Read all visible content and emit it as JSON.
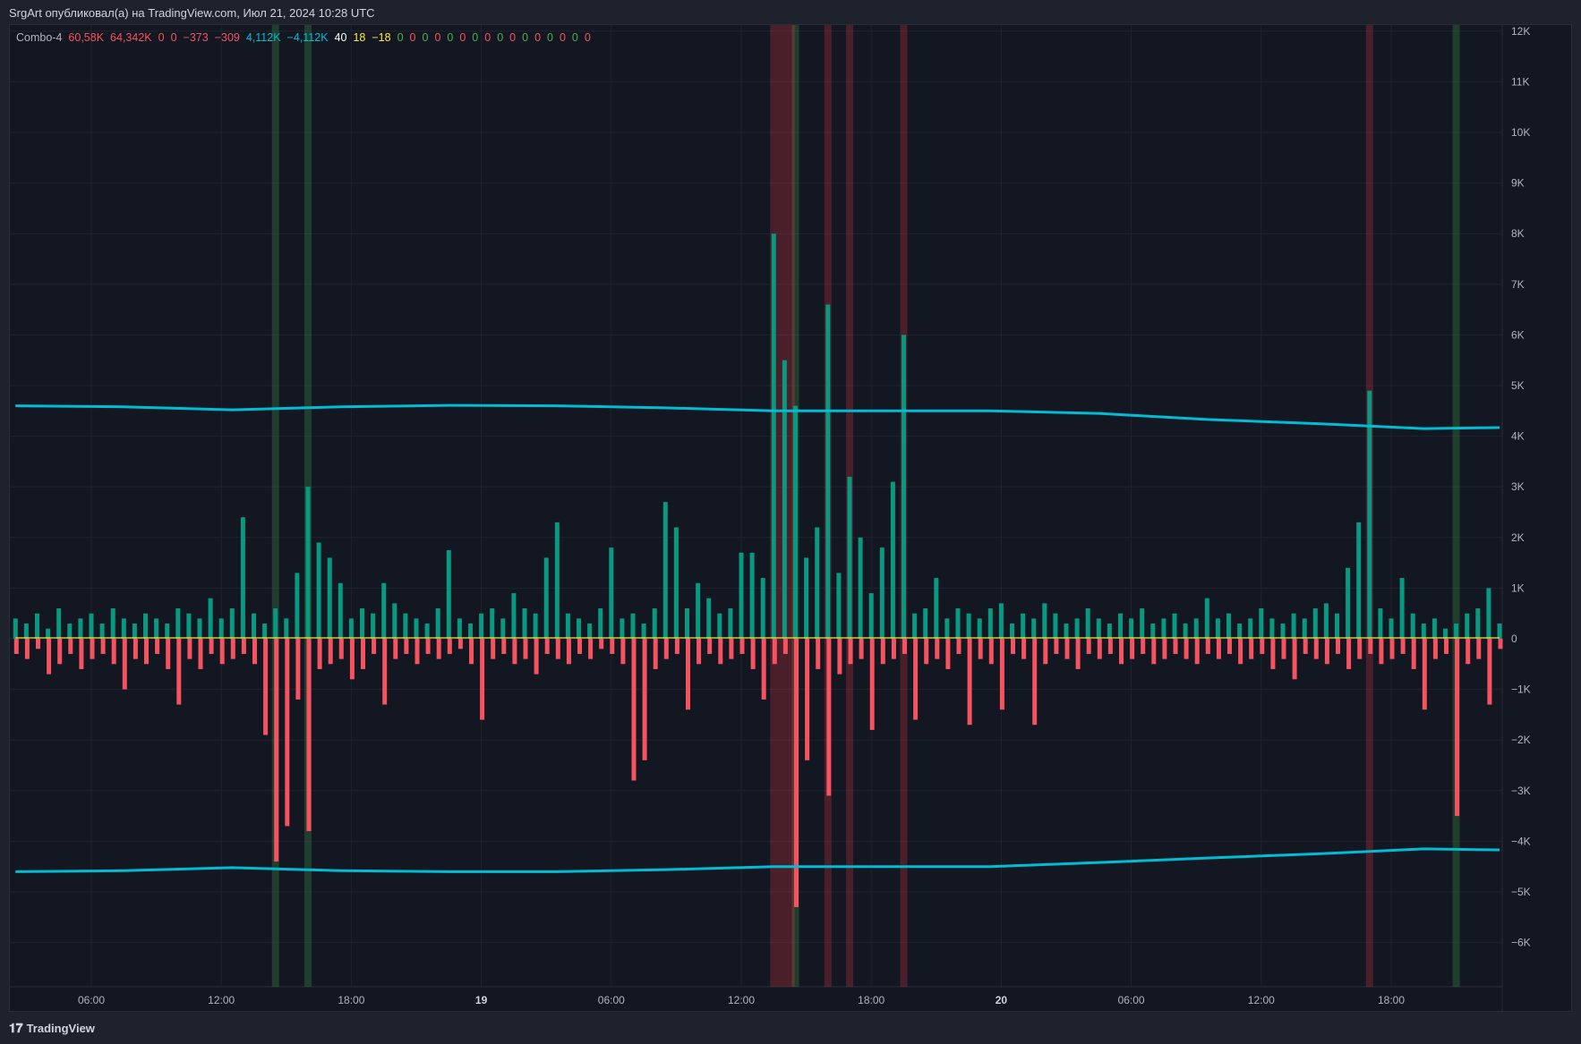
{
  "header": {
    "text": "SrgArt опубликовал(а) на TradingView.com, Июл 21, 2024 10:28 UTC"
  },
  "legend": {
    "name": "Combo-4",
    "values": [
      {
        "t": "60,58K",
        "c": "#f7525f"
      },
      {
        "t": "64,342K",
        "c": "#f7525f"
      },
      {
        "t": "0",
        "c": "#f7525f"
      },
      {
        "t": "0",
        "c": "#f7525f"
      },
      {
        "t": "−373",
        "c": "#f7525f"
      },
      {
        "t": "−309",
        "c": "#f7525f"
      },
      {
        "t": "4,112K",
        "c": "#00bcd4"
      },
      {
        "t": "−4,112K",
        "c": "#00bcd4"
      },
      {
        "t": "40",
        "c": "#ffffff"
      },
      {
        "t": "18",
        "c": "#ffeb3b"
      },
      {
        "t": "−18",
        "c": "#ffeb3b"
      },
      {
        "t": "0",
        "c": "#4caf50"
      },
      {
        "t": "0",
        "c": "#f7525f"
      },
      {
        "t": "0",
        "c": "#4caf50"
      },
      {
        "t": "0",
        "c": "#f7525f"
      },
      {
        "t": "0",
        "c": "#4caf50"
      },
      {
        "t": "0",
        "c": "#f7525f"
      },
      {
        "t": "0",
        "c": "#4caf50"
      },
      {
        "t": "0",
        "c": "#f7525f"
      },
      {
        "t": "0",
        "c": "#4caf50"
      },
      {
        "t": "0",
        "c": "#f7525f"
      },
      {
        "t": "0",
        "c": "#4caf50"
      },
      {
        "t": "0",
        "c": "#f7525f"
      },
      {
        "t": "0",
        "c": "#4caf50"
      },
      {
        "t": "0",
        "c": "#f7525f"
      },
      {
        "t": "0",
        "c": "#4caf50"
      },
      {
        "t": "0",
        "c": "#f7525f"
      }
    ]
  },
  "footer": {
    "brand": "TradingView"
  },
  "colors": {
    "up": "#089981",
    "down": "#f7525f",
    "band_line": "#00bcd4",
    "zero_line": "#ffeb3b",
    "green_band": "#4caf50",
    "red_band": "#f23645"
  },
  "chart_data": {
    "type": "bar",
    "title": "Combo-4",
    "units": "K",
    "x_start_hour": 2.5,
    "interval_hours": 0.5,
    "buy": [
      0.4,
      0.3,
      0.5,
      0.2,
      0.6,
      0.3,
      0.4,
      0.5,
      0.3,
      0.6,
      0.4,
      0.3,
      0.5,
      0.4,
      0.3,
      0.6,
      0.5,
      0.4,
      0.8,
      0.4,
      0.6,
      2.4,
      0.5,
      0.3,
      0.6,
      0.4,
      1.3,
      3.0,
      1.9,
      1.6,
      1.1,
      0.4,
      0.6,
      0.5,
      1.1,
      0.7,
      0.5,
      0.4,
      0.3,
      0.6,
      1.75,
      0.4,
      0.3,
      0.5,
      0.6,
      0.4,
      0.9,
      0.6,
      0.5,
      1.6,
      2.3,
      0.5,
      0.4,
      0.3,
      0.6,
      1.8,
      0.4,
      0.5,
      0.3,
      0.6,
      2.7,
      2.2,
      0.6,
      1.1,
      0.8,
      0.5,
      0.6,
      1.7,
      1.7,
      1.2,
      8.0,
      5.5,
      4.6,
      1.6,
      2.2,
      6.6,
      1.3,
      3.2,
      2.0,
      0.9,
      1.8,
      3.1,
      6.0,
      0.5,
      0.6,
      1.2,
      0.4,
      0.6,
      0.5,
      0.4,
      0.6,
      0.7,
      0.3,
      0.5,
      0.4,
      0.7,
      0.5,
      0.3,
      0.4,
      0.6,
      0.4,
      0.3,
      0.5,
      0.4,
      0.6,
      0.3,
      0.4,
      0.5,
      0.3,
      0.4,
      0.8,
      0.4,
      0.5,
      0.3,
      0.4,
      0.6,
      0.4,
      0.3,
      0.5,
      0.4,
      0.6,
      0.7,
      0.5,
      1.4,
      2.3,
      4.9,
      0.6,
      0.4,
      1.2,
      0.5,
      0.3,
      0.4,
      0.2,
      0.3,
      0.5,
      0.6,
      1.0,
      0.3
    ],
    "sell": [
      -0.3,
      -0.4,
      -0.2,
      -0.7,
      -0.5,
      -0.3,
      -0.6,
      -0.4,
      -0.3,
      -0.5,
      -1.0,
      -0.4,
      -0.5,
      -0.3,
      -0.6,
      -1.3,
      -0.4,
      -0.6,
      -0.3,
      -0.5,
      -0.4,
      -0.3,
      -0.5,
      -1.9,
      -4.4,
      -3.7,
      -1.2,
      -3.8,
      -0.6,
      -0.5,
      -0.4,
      -0.8,
      -0.6,
      -0.3,
      -1.3,
      -0.4,
      -0.3,
      -0.5,
      -0.3,
      -0.4,
      -0.3,
      -0.2,
      -0.5,
      -1.6,
      -0.4,
      -0.3,
      -0.5,
      -0.4,
      -0.7,
      -0.3,
      -0.4,
      -0.5,
      -0.3,
      -0.4,
      -0.2,
      -0.3,
      -0.5,
      -2.8,
      -2.4,
      -0.6,
      -0.4,
      -0.3,
      -1.4,
      -0.5,
      -0.3,
      -0.5,
      -0.4,
      -0.3,
      -0.6,
      -1.2,
      -0.5,
      -0.3,
      -5.3,
      -2.4,
      -0.6,
      -3.1,
      -0.7,
      -0.5,
      -0.4,
      -1.8,
      -0.5,
      -0.4,
      -0.3,
      -1.6,
      -0.5,
      -0.4,
      -0.6,
      -0.3,
      -1.7,
      -0.4,
      -0.5,
      -1.4,
      -0.3,
      -0.4,
      -1.7,
      -0.5,
      -0.3,
      -0.4,
      -0.6,
      -0.3,
      -0.4,
      -0.3,
      -0.5,
      -0.4,
      -0.3,
      -0.5,
      -0.4,
      -0.3,
      -0.4,
      -0.5,
      -0.3,
      -0.4,
      -0.3,
      -0.5,
      -0.4,
      -0.3,
      -0.6,
      -0.4,
      -0.8,
      -0.3,
      -0.4,
      -0.5,
      -0.3,
      -0.6,
      -0.4,
      -0.3,
      -0.5,
      -0.4,
      -0.3,
      -0.6,
      -1.4,
      -0.4,
      -0.3,
      -3.5,
      -0.5,
      -0.4,
      -1.3,
      -0.2
    ],
    "band_idx": [
      0,
      10,
      20,
      30,
      40,
      50,
      60,
      70,
      80,
      90,
      100,
      110,
      120,
      130,
      137
    ],
    "upper": [
      4.6,
      4.58,
      4.52,
      4.58,
      4.61,
      4.6,
      4.56,
      4.5,
      4.5,
      4.5,
      4.45,
      4.33,
      4.25,
      4.15,
      4.17
    ],
    "lower": [
      -4.6,
      -4.58,
      -4.52,
      -4.58,
      -4.6,
      -4.6,
      -4.56,
      -4.5,
      -4.5,
      -4.5,
      -4.42,
      -4.33,
      -4.25,
      -4.15,
      -4.17
    ],
    "highlight_green_idx": [
      24,
      27,
      72,
      133
    ],
    "highlight_red_ranges": [
      [
        70,
        71.6
      ],
      [
        75,
        75
      ],
      [
        77,
        77
      ],
      [
        82,
        82
      ],
      [
        125,
        125
      ]
    ],
    "ylim": [
      -6.9,
      12.2
    ],
    "yticks": [
      {
        "v": 12,
        "l": "12K"
      },
      {
        "v": 11,
        "l": "11K"
      },
      {
        "v": 10,
        "l": "10K"
      },
      {
        "v": 9,
        "l": "9K"
      },
      {
        "v": 8,
        "l": "8K"
      },
      {
        "v": 7,
        "l": "7K"
      },
      {
        "v": 6,
        "l": "6K"
      },
      {
        "v": 5,
        "l": "5K"
      },
      {
        "v": 4,
        "l": "4K"
      },
      {
        "v": 3,
        "l": "3K"
      },
      {
        "v": 2,
        "l": "2K"
      },
      {
        "v": 1,
        "l": "1K"
      },
      {
        "v": 0,
        "l": "0"
      },
      {
        "v": -1,
        "l": "−1K"
      },
      {
        "v": -2,
        "l": "−2K"
      },
      {
        "v": -3,
        "l": "−3K"
      },
      {
        "v": -4,
        "l": "−4K"
      },
      {
        "v": -5,
        "l": "−5K"
      },
      {
        "v": -6,
        "l": "−6K"
      }
    ],
    "xticks": [
      {
        "h": 6,
        "l": "06:00"
      },
      {
        "h": 12,
        "l": "12:00"
      },
      {
        "h": 18,
        "l": "18:00"
      },
      {
        "h": 24,
        "l": "19",
        "bold": true
      },
      {
        "h": 30,
        "l": "06:00"
      },
      {
        "h": 36,
        "l": "12:00"
      },
      {
        "h": 42,
        "l": "18:00"
      },
      {
        "h": 48,
        "l": "20",
        "bold": true
      },
      {
        "h": 54,
        "l": "06:00"
      },
      {
        "h": 60,
        "l": "12:00"
      },
      {
        "h": 66,
        "l": "18:00"
      }
    ]
  }
}
